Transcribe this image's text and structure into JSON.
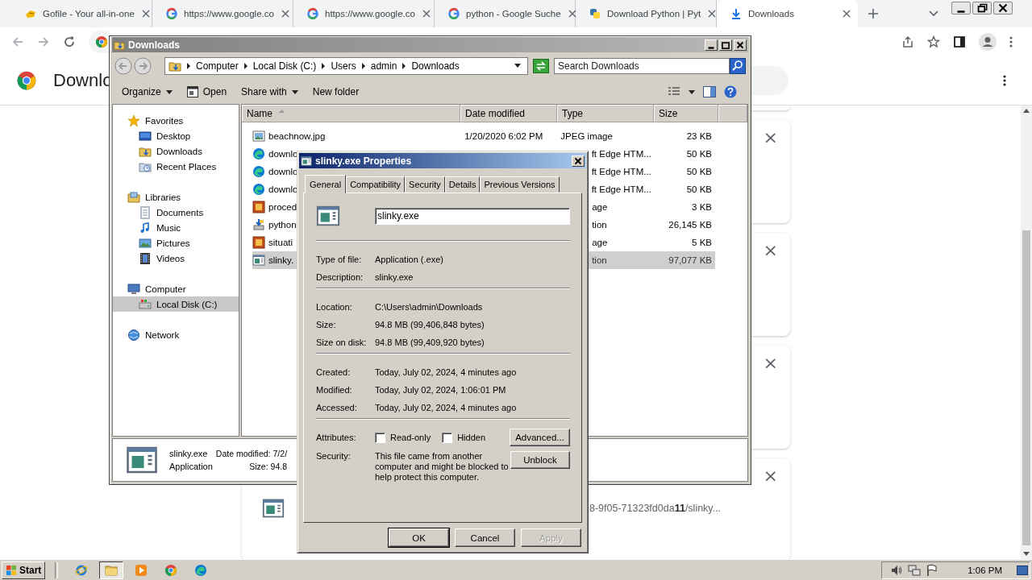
{
  "browser": {
    "tabs": [
      {
        "title": "Gofile - Your all-in-one",
        "selected": false
      },
      {
        "title": "https://www.google.co",
        "selected": false
      },
      {
        "title": "https://www.google.co",
        "selected": false
      },
      {
        "title": "python - Google Suche",
        "selected": false
      },
      {
        "title": "Download Python | Pyt",
        "selected": false
      },
      {
        "title": "Downloads",
        "selected": true
      }
    ],
    "page": {
      "title": "Downlo"
    },
    "downloads": [
      {
        "close": "×"
      },
      {
        "close": "×"
      },
      {
        "close": "×"
      },
      {
        "close": "×",
        "file": "8-9f05-71323fd0da**11**/slinky..."
      }
    ]
  },
  "explorer": {
    "title": "Downloads",
    "breadcrumb": [
      "Computer",
      "Local Disk (C:)",
      "Users",
      "admin",
      "Downloads"
    ],
    "search": {
      "placeholder": "Search Downloads"
    },
    "toolbar": [
      {
        "label": "Organize",
        "kind": "menu"
      },
      {
        "label": "Open",
        "kind": "open"
      },
      {
        "label": "Share with",
        "kind": "menu"
      },
      {
        "label": "New folder",
        "kind": "plain"
      }
    ],
    "nav": [
      {
        "label": "Favorites",
        "selected": false,
        "children": [
          {
            "label": "Desktop",
            "selected": false
          },
          {
            "label": "Downloads",
            "selected": false
          },
          {
            "label": "Recent Places",
            "selected": false
          }
        ]
      },
      {
        "label": "Libraries",
        "selected": false,
        "children": [
          {
            "label": "Documents",
            "selected": false
          },
          {
            "label": "Music",
            "selected": false
          },
          {
            "label": "Pictures",
            "selected": false
          },
          {
            "label": "Videos",
            "selected": false
          }
        ]
      },
      {
        "label": "Computer",
        "selected": false,
        "children": [
          {
            "label": "Local Disk (C:)",
            "selected": true
          }
        ]
      },
      {
        "label": "Network",
        "selected": false
      }
    ],
    "columns": [
      {
        "label": "Name",
        "sorted": true
      },
      {
        "label": "Date modified",
        "sorted": false
      },
      {
        "label": "Type",
        "sorted": false
      },
      {
        "label": "Size",
        "sorted": false
      }
    ],
    "rows": [
      {
        "name": "beachnow.jpg",
        "date": "1/20/2020 6:02 PM",
        "type": "JPEG image",
        "size": "23 KB",
        "selected": false
      },
      {
        "name": "downlo",
        "type": "ft Edge HTM...",
        "size": "50 KB",
        "selected": false
      },
      {
        "name": "downlo",
        "type": "ft Edge HTM...",
        "size": "50 KB",
        "selected": false
      },
      {
        "name": "downlo",
        "type": "ft Edge HTM...",
        "size": "50 KB",
        "selected": false
      },
      {
        "name": "proced",
        "type": "age",
        "size": "3 KB",
        "selected": false
      },
      {
        "name": "python",
        "type": "tion",
        "size": "26,145 KB",
        "selected": false
      },
      {
        "name": "situati",
        "type": "age",
        "size": "5 KB",
        "selected": false
      },
      {
        "name": "slinky.",
        "type": "tion",
        "size": "97,077 KB",
        "selected": true
      }
    ],
    "details": {
      "name": "slinky.exe",
      "kind": "Application",
      "props": [
        {
          "label": "Date modified:",
          "value": "7/2/"
        },
        {
          "label": "Size:",
          "value": "94.8"
        }
      ]
    }
  },
  "dialog": {
    "title": "slinky.exe Properties",
    "tabs": [
      {
        "label": "General",
        "selected": true
      },
      {
        "label": "Compatibility",
        "selected": false
      },
      {
        "label": "Security",
        "selected": false
      },
      {
        "label": "Details",
        "selected": false
      },
      {
        "label": "Previous Versions",
        "selected": false
      }
    ],
    "filename": "slinky.exe",
    "groups": [
      [
        {
          "label": "Type of file:",
          "value": "Application (.exe)"
        },
        {
          "label": "Description:",
          "value": "slinky.exe"
        }
      ],
      [
        {
          "label": "Location:",
          "value": "C:\\Users\\admin\\Downloads"
        },
        {
          "label": "Size:",
          "value": "94.8 MB (99,406,848 bytes)"
        },
        {
          "label": "Size on disk:",
          "value": "94.8 MB (99,409,920 bytes)"
        }
      ],
      [
        {
          "label": "Created:",
          "value": "Today, July 02, 2024, 4 minutes ago"
        },
        {
          "label": "Modified:",
          "value": "Today, July 02, 2024, 1:06:01 PM"
        },
        {
          "label": "Accessed:",
          "value": "Today, July 02, 2024, 4 minutes ago"
        }
      ]
    ],
    "attributes": {
      "label": "Attributes:",
      "checkboxes": [
        {
          "label": "Read-only",
          "checked": false
        },
        {
          "label": "Hidden",
          "checked": false
        }
      ],
      "button": "Advanced..."
    },
    "security": {
      "label": "Security:",
      "text": "This file came from another computer and might be blocked to help protect this computer.",
      "button": "Unblock"
    },
    "buttons": [
      {
        "label": "OK",
        "default": true,
        "disabled": false
      },
      {
        "label": "Cancel",
        "default": false,
        "disabled": false
      },
      {
        "label": "Apply",
        "default": false,
        "disabled": true
      }
    ]
  },
  "taskbar": {
    "start": "Start",
    "apps": [
      {
        "selected": false
      },
      {
        "selected": true
      },
      {
        "selected": false
      },
      {
        "selected": false
      },
      {
        "selected": false
      }
    ],
    "clock": "1:06 PM"
  }
}
